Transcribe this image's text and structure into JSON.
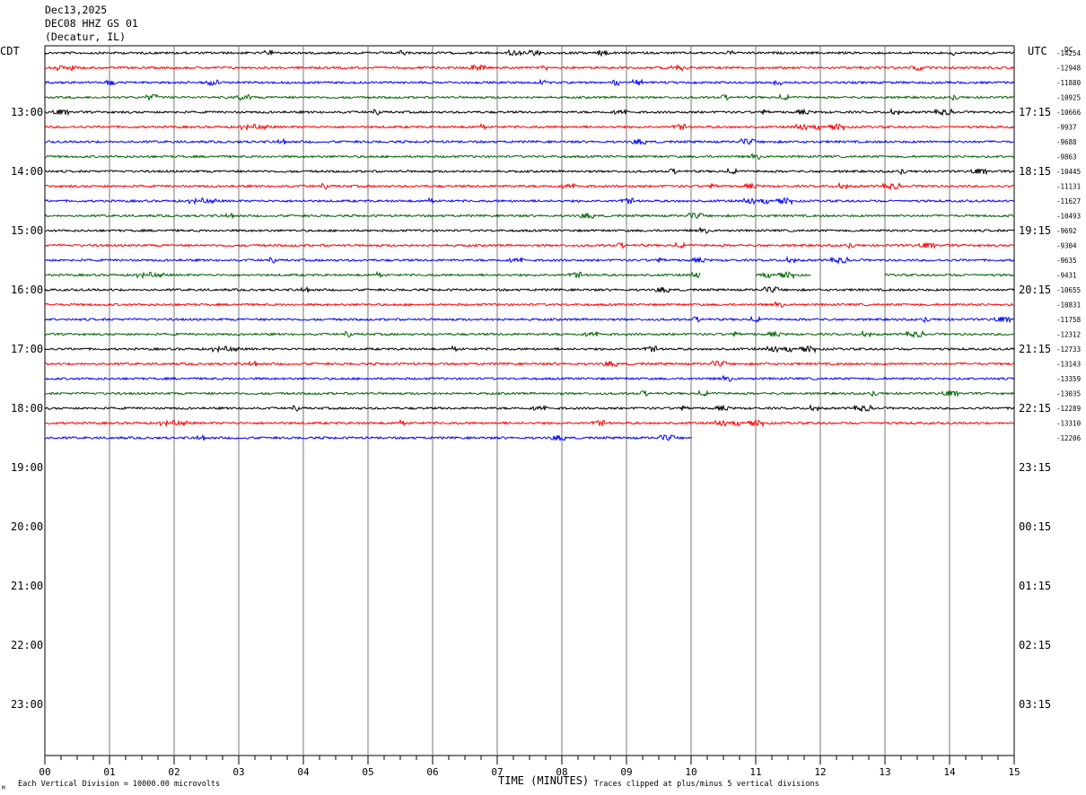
{
  "header": {
    "date": "Dec13,2025",
    "station": "DEC08 HHZ GS 01",
    "location": "(Decatur, IL)"
  },
  "left_zone_label": "CDT",
  "right_zone_label": "UTC",
  "dc_label": "DC",
  "footer": {
    "scale_note": "Each Vertical Division = 10000.00 microvolts",
    "clip_note": "Traces clipped at plus/minus 5 vertical divisions",
    "corner_mark": "M"
  },
  "chart_data": {
    "type": "line",
    "title": "",
    "xlabel": "TIME (MINUTES)",
    "ylabel": "",
    "xlim": [
      0,
      15
    ],
    "x_ticks": [
      "00",
      "01",
      "02",
      "03",
      "04",
      "05",
      "06",
      "07",
      "08",
      "09",
      "10",
      "11",
      "12",
      "13",
      "14",
      "15"
    ],
    "minor_tick_step_minutes": 0.25,
    "grid": "vertical lines at each minute",
    "trace_colors": [
      "#000000",
      "#ff0000",
      "#0000ff",
      "#006400"
    ],
    "left_time_labels": [
      "13:00",
      "14:00",
      "15:00",
      "16:00",
      "17:00",
      "18:00",
      "19:00",
      "20:00",
      "21:00",
      "22:00",
      "23:00"
    ],
    "right_time_labels": [
      "17:15",
      "18:15",
      "19:15",
      "20:15",
      "21:15",
      "22:15",
      "23:15",
      "00:15",
      "01:15",
      "02:15",
      "03:15"
    ],
    "traces": [
      {
        "color_index": 0,
        "dc": "-14254",
        "gaps": [],
        "end_minute": 15
      },
      {
        "color_index": 1,
        "dc": "-12948",
        "gaps": [],
        "end_minute": 15
      },
      {
        "color_index": 2,
        "dc": "-11880",
        "gaps": [],
        "end_minute": 15
      },
      {
        "color_index": 3,
        "dc": "-10925",
        "gaps": [],
        "end_minute": 15
      },
      {
        "color_index": 0,
        "dc": "-10666",
        "gaps": [],
        "end_minute": 15
      },
      {
        "color_index": 1,
        "dc": "-9937",
        "gaps": [],
        "end_minute": 15
      },
      {
        "color_index": 2,
        "dc": "-9688",
        "gaps": [],
        "end_minute": 15
      },
      {
        "color_index": 3,
        "dc": "-9863",
        "gaps": [],
        "end_minute": 15
      },
      {
        "color_index": 0,
        "dc": "-10445",
        "gaps": [],
        "end_minute": 15
      },
      {
        "color_index": 1,
        "dc": "-11131",
        "gaps": [],
        "end_minute": 15
      },
      {
        "color_index": 2,
        "dc": "-11627",
        "gaps": [],
        "end_minute": 15
      },
      {
        "color_index": 3,
        "dc": "-10493",
        "gaps": [],
        "end_minute": 15
      },
      {
        "color_index": 0,
        "dc": "-9692",
        "gaps": [],
        "end_minute": 15
      },
      {
        "color_index": 1,
        "dc": "-9304",
        "gaps": [],
        "end_minute": 15
      },
      {
        "color_index": 2,
        "dc": "-9635",
        "gaps": [],
        "end_minute": 15
      },
      {
        "color_index": 3,
        "dc": "-9431",
        "gaps": [
          [
            10.15,
            11.0
          ],
          [
            11.85,
            13.0
          ]
        ],
        "end_minute": 15
      },
      {
        "color_index": 0,
        "dc": "-10655",
        "gaps": [],
        "end_minute": 15
      },
      {
        "color_index": 1,
        "dc": "-10831",
        "gaps": [],
        "end_minute": 15
      },
      {
        "color_index": 2,
        "dc": "-11758",
        "gaps": [],
        "end_minute": 15
      },
      {
        "color_index": 3,
        "dc": "-12312",
        "gaps": [],
        "end_minute": 15
      },
      {
        "color_index": 0,
        "dc": "-12733",
        "gaps": [],
        "end_minute": 15
      },
      {
        "color_index": 1,
        "dc": "-13143",
        "gaps": [],
        "end_minute": 15
      },
      {
        "color_index": 2,
        "dc": "-13359",
        "gaps": [],
        "end_minute": 15
      },
      {
        "color_index": 3,
        "dc": "-13035",
        "gaps": [],
        "end_minute": 15
      },
      {
        "color_index": 0,
        "dc": "-12289",
        "gaps": [],
        "end_minute": 15
      },
      {
        "color_index": 1,
        "dc": "-13310",
        "gaps": [],
        "end_minute": 15
      },
      {
        "color_index": 2,
        "dc": "-12206",
        "gaps": [],
        "end_minute": 10.02
      }
    ]
  }
}
